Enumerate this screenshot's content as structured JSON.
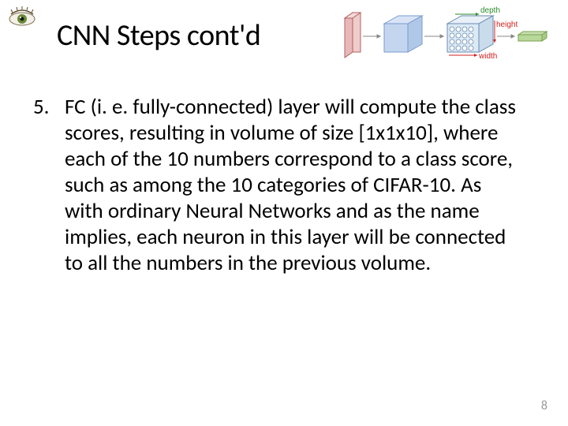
{
  "logo": {
    "name": "eye-logo"
  },
  "title": "CNN Steps cont'd",
  "diagram": {
    "labels": {
      "depth": "depth",
      "height": "height",
      "width": "width"
    }
  },
  "list": {
    "item5": {
      "number": "5.",
      "text": "FC (i. e. fully-connected) layer will compute the class scores, resulting in volume of size [1x1x10], where each of the 10 numbers correspond to a class score, such as among the 10 categories of CIFAR-10. As with ordinary Neural Networks and as the name implies, each neuron in this layer will be connected to all the numbers in the previous volume."
    }
  },
  "page_number": "8"
}
